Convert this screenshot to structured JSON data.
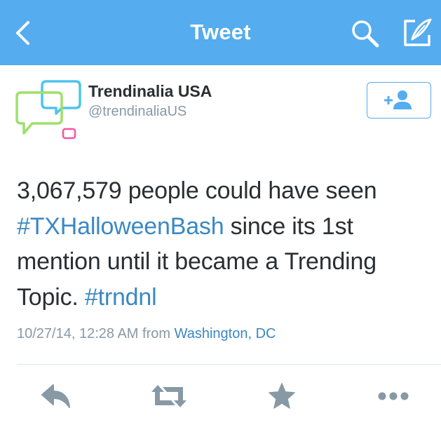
{
  "nav": {
    "title": "Tweet"
  },
  "author": {
    "name": "Trendinalia USA",
    "handle": "@trendinaliaUS"
  },
  "tweet": {
    "text_before": "3,067,579 people could have seen ",
    "hashtag_1": "#TXHalloweenBash",
    "text_middle": " since its 1st mention until it became a Trending Topic. ",
    "hashtag_2": "#trndnl"
  },
  "meta": {
    "timestamp": "10/27/14, 12:28 AM",
    "from_label": "from",
    "location": "Washington, DC"
  },
  "colors": {
    "nav_bg": "#55acee",
    "link": "#3b88c3",
    "text": "#292f33",
    "muted": "#8899a6",
    "icon": "#8899a6"
  },
  "icons": {
    "back": "chevron-left",
    "search": "search",
    "compose": "compose",
    "follow": "add-user",
    "reply": "reply",
    "retweet": "retweet",
    "favorite": "star",
    "more": "more"
  }
}
